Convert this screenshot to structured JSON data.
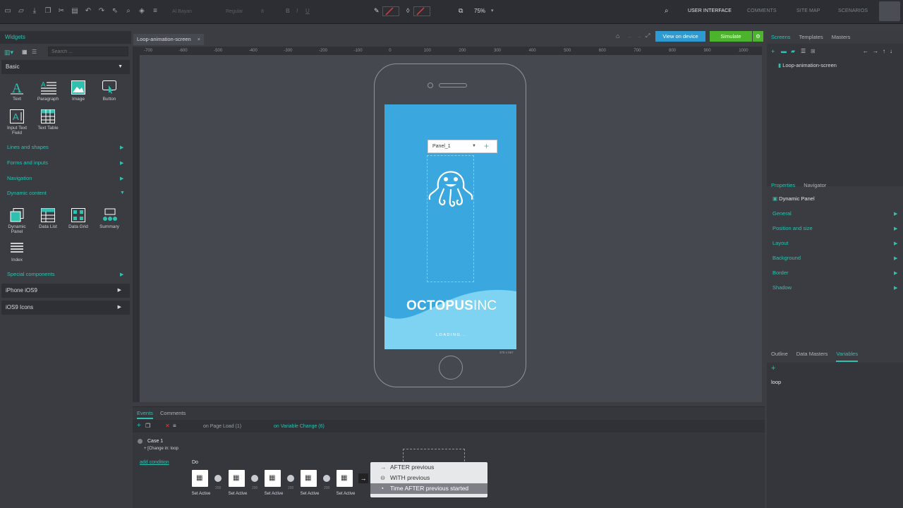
{
  "toolbar": {
    "font_name": "Al Bayan",
    "font_style": "Regular",
    "font_size": "8",
    "zoom": "75%",
    "nav": [
      "USER INTERFACE",
      "COMMENTS",
      "SITE MAP",
      "SCENARIOS"
    ]
  },
  "left": {
    "header": "Widgets",
    "search_placeholder": "Search ...",
    "basic_title": "Basic",
    "basic_items": [
      "Text",
      "Paragraph",
      "Image",
      "Button",
      "Input Text Field",
      "Text Table"
    ],
    "sections": [
      "Lines and shapes",
      "Forms and inputs",
      "Navigation",
      "Dynamic content"
    ],
    "dynamic_items": [
      "Dynamic Panel",
      "Data List",
      "Data Grid",
      "Summary",
      "Index"
    ],
    "special": "Special components",
    "libraries": [
      "iPhone iOS9",
      "iOS9 Icons"
    ]
  },
  "doc": {
    "tab": "Loop-animation-screen",
    "ruler": [
      "-700",
      "-600",
      "-500",
      "-400",
      "-300",
      "-200",
      "-100",
      "0",
      "100",
      "200",
      "300",
      "400",
      "500",
      "600",
      "700",
      "800",
      "900",
      "1000"
    ]
  },
  "phone": {
    "panel_name": "Panel_1",
    "brand_bold": "OCTOPUS",
    "brand_light": "INC",
    "loading": "LOADING...",
    "size": "375 x 667"
  },
  "top_actions": {
    "view_device": "View on device",
    "simulate": "Simulate"
  },
  "right": {
    "tabs": [
      "Screens",
      "Templates",
      "Masters"
    ],
    "screen_item": "Loop-animation-screen",
    "prop_tabs": [
      "Properties",
      "Navigator"
    ],
    "selected": "Dynamic Panel",
    "props": [
      "General",
      "Position and size",
      "Layout",
      "Background",
      "Border",
      "Shadow"
    ],
    "bottom_tabs": [
      "Outline",
      "Data Masters",
      "Variables"
    ],
    "variable": "loop"
  },
  "events": {
    "tabs": [
      "Events",
      "Comments"
    ],
    "triggers": [
      "on Page Load (1)",
      "on Variable Change (6)"
    ],
    "case": "Case 1",
    "condition": "+ [Change in: loop",
    "add_condition": "add condition",
    "do": "Do",
    "action_label": "Set Active",
    "delay": "200",
    "menu": [
      "AFTER previous",
      "WITH previous",
      "Time AFTER previous started"
    ]
  },
  "colors": {
    "accent": "#2fc0b0",
    "view_device": "#2d9bd1",
    "simulate": "#4cb32d",
    "screen": "#3aa8de"
  }
}
